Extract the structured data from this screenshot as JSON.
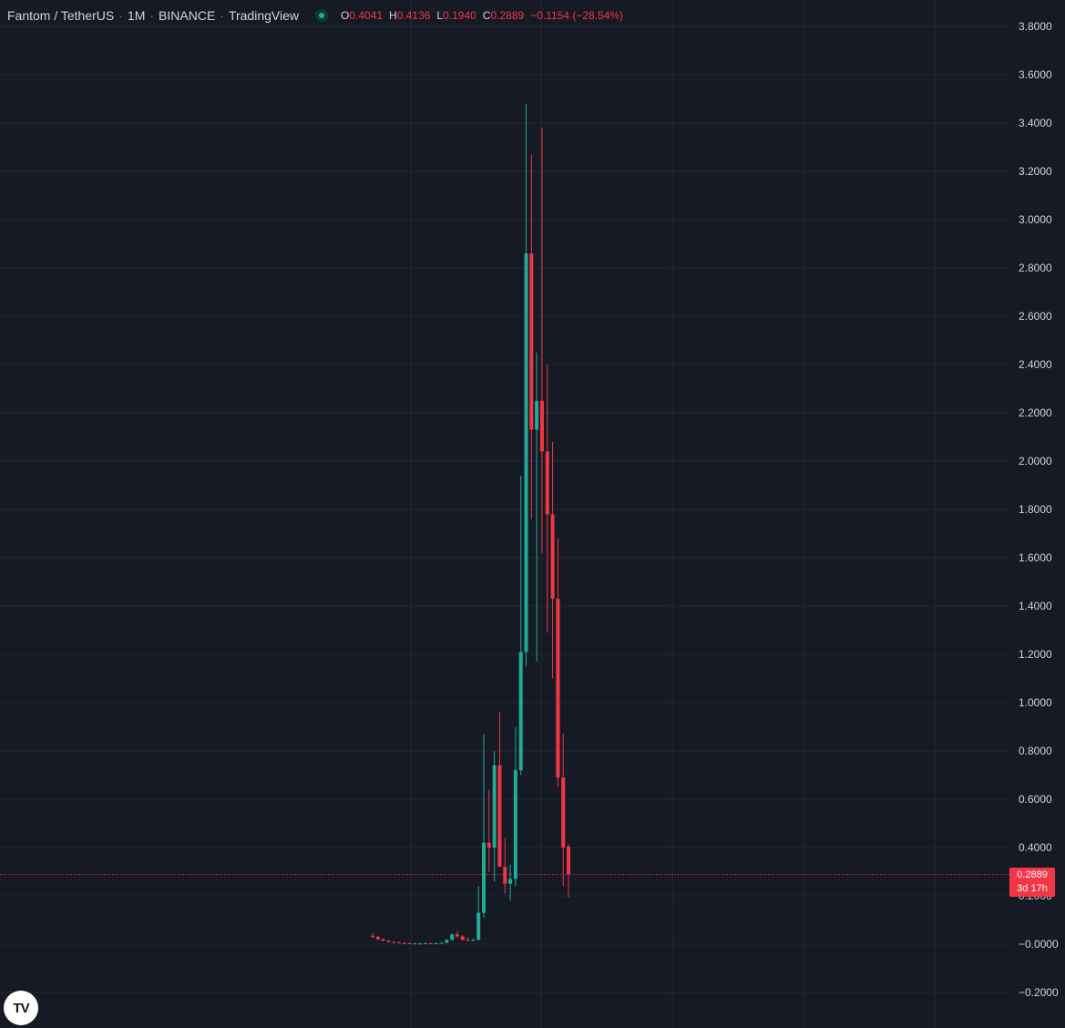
{
  "header": {
    "symbol": "Fantom / TetherUS",
    "interval": "1M",
    "exchange": "BINANCE",
    "source": "TradingView",
    "ohlc": {
      "o_label": "O",
      "o": "0.4041",
      "h_label": "H",
      "h": "0.4136",
      "l_label": "L",
      "l": "0.1940",
      "c_label": "C",
      "c": "0.2889",
      "change": "−0.1154 (−28.54%)"
    }
  },
  "price_tag": {
    "price": "0.2889",
    "countdown": "3d 17h"
  },
  "logo": {
    "text": "TV"
  },
  "colors": {
    "background": "#161a25",
    "grid": "#232733",
    "up": "#22ab94",
    "down": "#f23645",
    "axis_text": "#d1d4dc"
  },
  "chart_data": {
    "type": "candlestick",
    "title": "",
    "ylim": [
      -0.3,
      3.95
    ],
    "y_ticks": [
      "3.8000",
      "3.6000",
      "3.4000",
      "3.2000",
      "3.0000",
      "2.8000",
      "2.6000",
      "2.4000",
      "2.2000",
      "2.0000",
      "1.8000",
      "1.6000",
      "1.4000",
      "1.2000",
      "1.0000",
      "0.8000",
      "0.6000",
      "0.4000",
      "0.2000",
      "−0.0000",
      "−0.2000"
    ],
    "current_price": 0.2889,
    "candles": [
      {
        "o": 0.035,
        "h": 0.045,
        "l": 0.025,
        "c": 0.03
      },
      {
        "o": 0.03,
        "h": 0.034,
        "l": 0.018,
        "c": 0.02
      },
      {
        "o": 0.02,
        "h": 0.024,
        "l": 0.012,
        "c": 0.014
      },
      {
        "o": 0.014,
        "h": 0.017,
        "l": 0.008,
        "c": 0.009
      },
      {
        "o": 0.009,
        "h": 0.012,
        "l": 0.006,
        "c": 0.008
      },
      {
        "o": 0.008,
        "h": 0.01,
        "l": 0.004,
        "c": 0.005
      },
      {
        "o": 0.005,
        "h": 0.008,
        "l": 0.003,
        "c": 0.004
      },
      {
        "o": 0.004,
        "h": 0.006,
        "l": 0.002,
        "c": 0.003
      },
      {
        "o": 0.003,
        "h": 0.005,
        "l": 0.002,
        "c": 0.003
      },
      {
        "o": 0.003,
        "h": 0.005,
        "l": 0.002,
        "c": 0.003
      },
      {
        "o": 0.003,
        "h": 0.006,
        "l": 0.002,
        "c": 0.004
      },
      {
        "o": 0.004,
        "h": 0.006,
        "l": 0.002,
        "c": 0.003
      },
      {
        "o": 0.003,
        "h": 0.006,
        "l": 0.002,
        "c": 0.004
      },
      {
        "o": 0.004,
        "h": 0.007,
        "l": 0.002,
        "c": 0.006
      },
      {
        "o": 0.006,
        "h": 0.02,
        "l": 0.004,
        "c": 0.018
      },
      {
        "o": 0.018,
        "h": 0.045,
        "l": 0.015,
        "c": 0.04
      },
      {
        "o": 0.04,
        "h": 0.055,
        "l": 0.028,
        "c": 0.032
      },
      {
        "o": 0.032,
        "h": 0.038,
        "l": 0.015,
        "c": 0.018
      },
      {
        "o": 0.018,
        "h": 0.028,
        "l": 0.012,
        "c": 0.016
      },
      {
        "o": 0.016,
        "h": 0.022,
        "l": 0.012,
        "c": 0.018
      },
      {
        "o": 0.018,
        "h": 0.24,
        "l": 0.015,
        "c": 0.13
      },
      {
        "o": 0.13,
        "h": 0.87,
        "l": 0.11,
        "c": 0.42
      },
      {
        "o": 0.42,
        "h": 0.64,
        "l": 0.3,
        "c": 0.4
      },
      {
        "o": 0.4,
        "h": 0.8,
        "l": 0.26,
        "c": 0.74
      },
      {
        "o": 0.74,
        "h": 0.96,
        "l": 0.33,
        "c": 0.32
      },
      {
        "o": 0.32,
        "h": 0.44,
        "l": 0.21,
        "c": 0.25
      },
      {
        "o": 0.25,
        "h": 0.33,
        "l": 0.18,
        "c": 0.27
      },
      {
        "o": 0.27,
        "h": 0.9,
        "l": 0.24,
        "c": 0.72
      },
      {
        "o": 0.72,
        "h": 1.94,
        "l": 0.7,
        "c": 1.21
      },
      {
        "o": 1.21,
        "h": 3.48,
        "l": 1.15,
        "c": 2.86
      },
      {
        "o": 2.86,
        "h": 3.27,
        "l": 1.76,
        "c": 2.13
      },
      {
        "o": 2.13,
        "h": 2.45,
        "l": 1.17,
        "c": 2.25
      },
      {
        "o": 2.25,
        "h": 3.38,
        "l": 1.62,
        "c": 2.04
      },
      {
        "o": 2.04,
        "h": 2.4,
        "l": 1.29,
        "c": 1.78
      },
      {
        "o": 1.78,
        "h": 2.08,
        "l": 1.1,
        "c": 1.43
      },
      {
        "o": 1.43,
        "h": 1.68,
        "l": 0.65,
        "c": 0.69
      },
      {
        "o": 0.69,
        "h": 0.87,
        "l": 0.24,
        "c": 0.4
      },
      {
        "o": 0.404,
        "h": 0.4136,
        "l": 0.194,
        "c": 0.2889
      }
    ]
  }
}
